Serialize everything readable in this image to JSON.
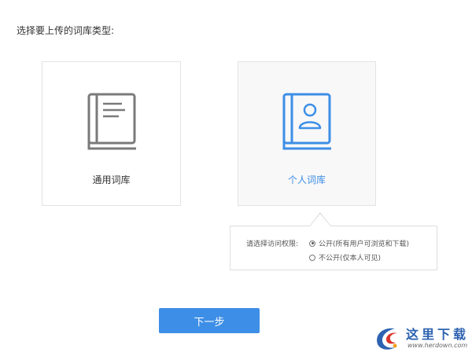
{
  "prompt": "选择要上传的词库类型:",
  "cards": [
    {
      "label": "通用词库",
      "icon": "book-icon",
      "selected": false
    },
    {
      "label": "个人词库",
      "icon": "contact-book-icon",
      "selected": true
    }
  ],
  "access": {
    "label": "请选择访问权限:",
    "options": [
      {
        "label": "公开(所有用户可浏览和下载)",
        "checked": true
      },
      {
        "label": "不公开(仅本人可见)",
        "checked": false
      }
    ]
  },
  "next_button": {
    "label": "下一步"
  },
  "watermark": {
    "title": "这里下载",
    "url": "www.herdown.com"
  },
  "colors": {
    "accent": "#3d8ee6",
    "icon_gray": "#7a7a7a",
    "border": "#e3e3e3"
  }
}
